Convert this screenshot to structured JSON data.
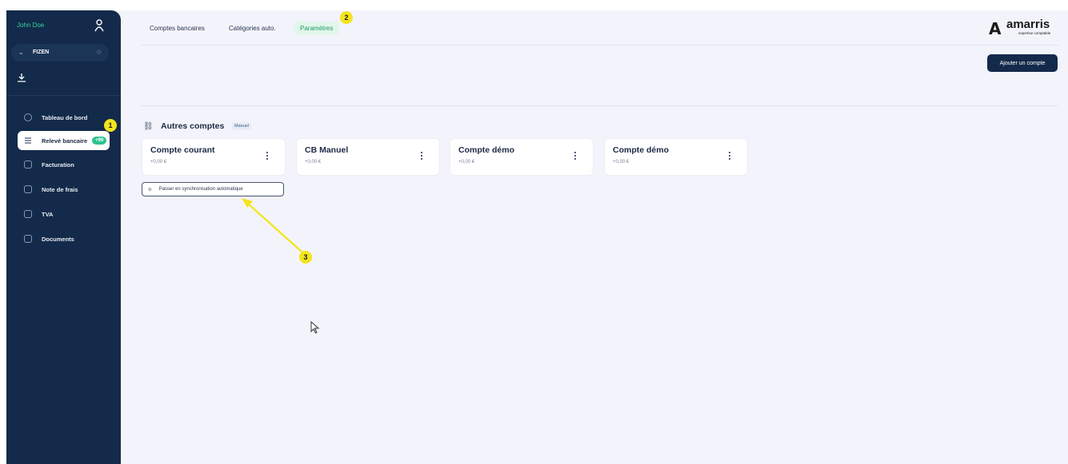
{
  "sidebar": {
    "user_name": "John Doe",
    "org_name": "FIZEN",
    "nav": [
      {
        "label": "Tableau de bord"
      },
      {
        "label": "Relevé bancaire",
        "badge": "+99"
      },
      {
        "label": "Facturation"
      },
      {
        "label": "Note de frais"
      },
      {
        "label": "TVA"
      },
      {
        "label": "Documents"
      }
    ]
  },
  "tabs": [
    {
      "label": "Comptes bancaires"
    },
    {
      "label": "Catégories auto."
    },
    {
      "label": "Paramètres"
    }
  ],
  "logo": {
    "mark": "A",
    "word": "amarris",
    "sub": "expertise comptable"
  },
  "add_account_label": "Ajouter un compte",
  "section": {
    "title": "Autres comptes",
    "tag": "Manuel"
  },
  "cards": [
    {
      "title": "Compte courant",
      "value": "+0,00 €"
    },
    {
      "title": "CB Manuel",
      "value": "+0,00 €"
    },
    {
      "title": "Compte démo",
      "value": "+0,00 €"
    },
    {
      "title": "Compte démo",
      "value": "+0,00 €"
    }
  ],
  "sync_button_label": "Passer en synchronisation automatique",
  "markers": [
    "1",
    "2",
    "3"
  ],
  "colors": {
    "sidebar": "#132a4a",
    "accent": "#2ec28e",
    "annotation": "#f4e41c",
    "background": "#f3f4fb"
  }
}
